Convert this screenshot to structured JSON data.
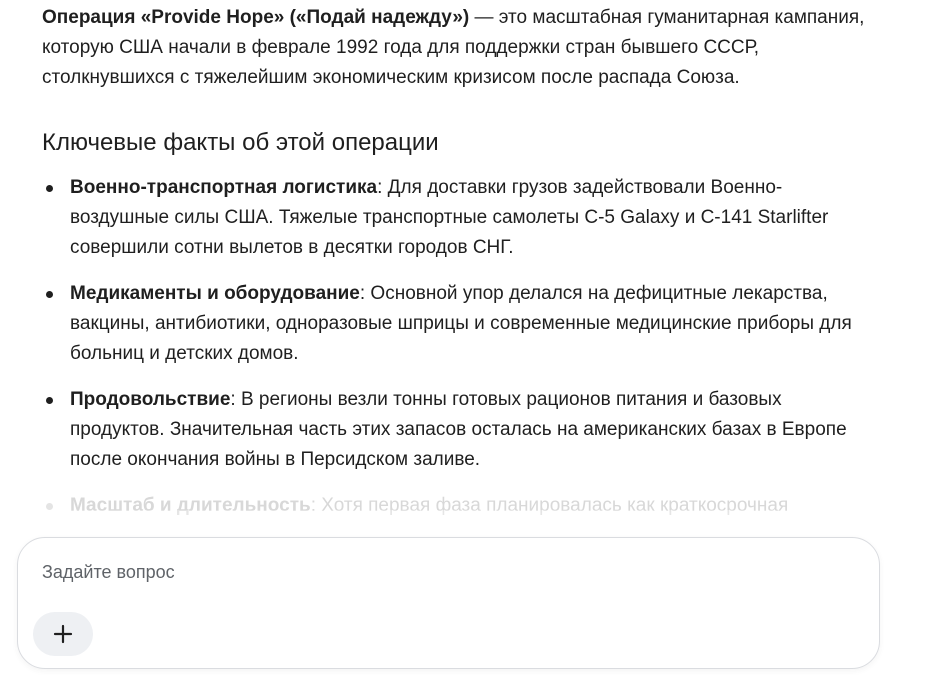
{
  "article": {
    "intro_bold": "Операция «Provide Hope» («Подай надежду»)",
    "intro_text": " — это масштабная гуманитарная кампания, которую США начали в феврале 1992 года для поддержки стран бывшего СССР, столкнувшихся с тяжелейшим экономическим кризисом после распада Союза.",
    "section_title": "Ключевые факты об этой операции",
    "facts": [
      {
        "title": "Военно-транспортная логистика",
        "text": ": Для доставки грузов задействовали Военно-воздушные силы США. Тяжелые транспортные самолеты C-5 Galaxy и C-141 Starlifter совершили сотни вылетов в десятки городов СНГ."
      },
      {
        "title": "Медикаменты и оборудование",
        "text": ": Основной упор делался на дефицитные лекарства, вакцины, антибиотики, одноразовые шприцы и современные медицинские приборы для больниц и детских домов."
      },
      {
        "title": "Продовольствие",
        "text": ": В регионы везли тонны готовых рационов питания и базовых продуктов. Значительная часть этих запасов осталась на американских базах в Европе после окончания войны в Персидском заливе."
      },
      {
        "title": "Масштаб и длительность",
        "text": ": Хотя первая фаза планировалась как краткосрочная"
      }
    ]
  },
  "composer": {
    "placeholder": "Задайте вопрос",
    "add_icon": "plus-icon"
  }
}
